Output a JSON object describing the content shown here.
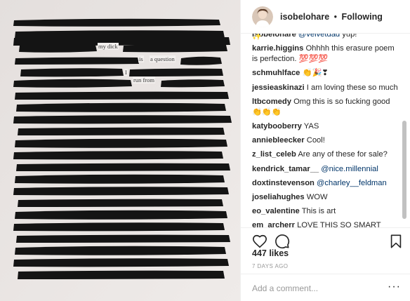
{
  "header": {
    "username": "isobelohare",
    "separator": "•",
    "follow_status": "Following"
  },
  "photo": {
    "visible_words": [
      "my dick",
      "is",
      "a question",
      "I",
      "run from"
    ]
  },
  "comments": [
    {
      "user": "isobelohare",
      "mention": "@velvetdad",
      "text": " yup!"
    },
    {
      "user": "karrie.higgins",
      "mention": "",
      "text": "Ohhhh this erasure poem is perfection. 💯💯💯"
    },
    {
      "user": "schmuhlface",
      "mention": "",
      "text": "👏🎉❣"
    },
    {
      "user": "jessieaskinazi",
      "mention": "",
      "text": "I am loving these so much"
    },
    {
      "user": "ltbcomedy",
      "mention": "",
      "text": "Omg this is so fucking good 👏👏👏"
    },
    {
      "user": "katybooberry",
      "mention": "",
      "text": "YAS"
    },
    {
      "user": "anniebleecker",
      "mention": "",
      "text": "Cool!"
    },
    {
      "user": "z_list_celeb",
      "mention": "",
      "text": "Are any of these for sale?"
    },
    {
      "user": "kendrick_tamar__",
      "mention": "@nice.millennial",
      "text": ""
    },
    {
      "user": "doxtinstevenson",
      "mention": "@charley__feldman",
      "text": ""
    },
    {
      "user": "joseliahughes",
      "mention": "",
      "text": "WOW"
    },
    {
      "user": "eo_valentine",
      "mention": "",
      "text": "This is art"
    },
    {
      "user": "em_archerr",
      "mention": "",
      "text": "LOVE THIS SO SMART AND SO TELLING 💜⭐💜"
    }
  ],
  "actions": {
    "icons": [
      "heart-icon",
      "comment-icon",
      "bookmark-icon"
    ]
  },
  "likes": "447 likes",
  "date": "7 DAYS AGO",
  "add_comment": {
    "placeholder": "Add a comment...",
    "more": "···"
  }
}
